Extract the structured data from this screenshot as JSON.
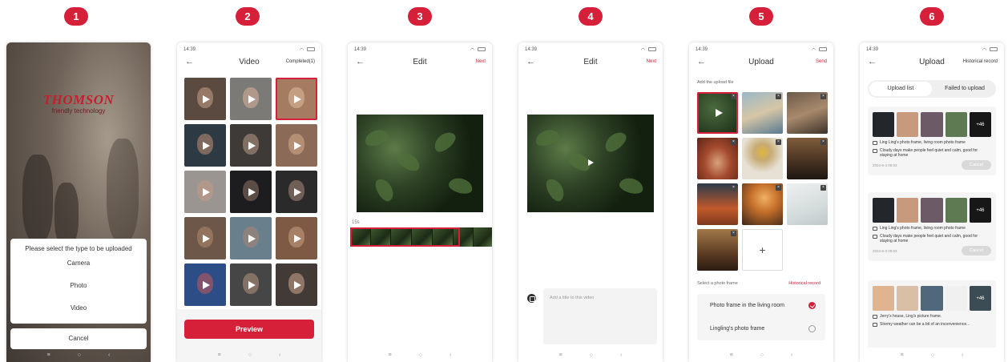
{
  "steps": [
    "1",
    "2",
    "3",
    "4",
    "5",
    "6"
  ],
  "status": {
    "time": "14:39"
  },
  "accent_color": "#d6203a",
  "screen1": {
    "brand": "THOMSON",
    "tagline": "friendly technology",
    "sheet_title": "Please select the type to be uploaded",
    "options": [
      "Camera",
      "Photo",
      "Video"
    ],
    "cancel": "Cancel"
  },
  "screen2": {
    "title": "Video",
    "action": "Completed(1)",
    "preview": "Preview"
  },
  "screen3": {
    "title": "Edit",
    "action": "Next",
    "duration": "15s"
  },
  "screen4": {
    "title": "Edit",
    "action": "Next",
    "title_placeholder": "Add a title to this video"
  },
  "screen5": {
    "title": "Upload",
    "action": "Send",
    "add_label": "Add the upload file",
    "frame_label": "Select a photo frame",
    "history_link": "Historical record",
    "add_symbol": "+",
    "frames": [
      {
        "name": "Photo frame in the living room",
        "selected": true
      },
      {
        "name": "Lingling's photo frame",
        "selected": false
      }
    ]
  },
  "screen6": {
    "title": "Upload",
    "action": "Historical record",
    "tabs": [
      "Upload list",
      "Failed to upload"
    ],
    "cards": [
      {
        "frames": "Ling Ling's photo frame, living room photo frame",
        "text": "Cloudy days make people feel quiet and calm, good for staying at home",
        "date": "2024-6-4 09:03",
        "more": "+46",
        "button": "Cancel"
      },
      {
        "frames": "Ling Ling's photo frame, living room photo frame",
        "text": "Cloudy days make people feel quiet and calm, good for staying at home",
        "date": "2024-6-3 09:03",
        "more": "+46",
        "button": "Cancel"
      },
      {
        "frames": "Jerry's house, Ling's picture frame.",
        "text": "Stormy weather can be a bit of an inconvenience...",
        "date": "",
        "more": "+46",
        "button": ""
      }
    ]
  }
}
